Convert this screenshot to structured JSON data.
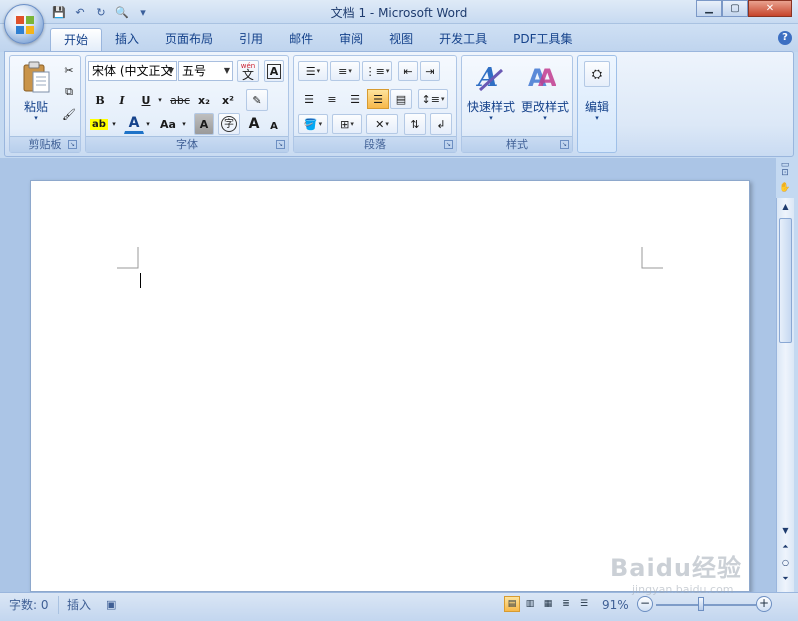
{
  "window": {
    "title": "文档 1 - Microsoft Word"
  },
  "tabs": [
    {
      "label": "开始",
      "active": true
    },
    {
      "label": "插入"
    },
    {
      "label": "页面布局"
    },
    {
      "label": "引用"
    },
    {
      "label": "邮件"
    },
    {
      "label": "审阅"
    },
    {
      "label": "视图"
    },
    {
      "label": "开发工具"
    },
    {
      "label": "PDF工具集"
    }
  ],
  "ribbon": {
    "clipboard": {
      "label": "剪贴板",
      "paste": "粘贴"
    },
    "font": {
      "label": "字体",
      "font_name": "宋体 (中文正文",
      "font_size": "五号",
      "bold": "B",
      "italic": "I",
      "underline": "U",
      "strike": "abc",
      "subscript": "x₂",
      "superscript": "x²",
      "grow": "A",
      "shrink": "A",
      "case": "Aa",
      "font_color": "A",
      "char_shade": "A",
      "enclose": "字",
      "phonetic": "wén",
      "phonetic_char": "文"
    },
    "paragraph": {
      "label": "段落"
    },
    "styles": {
      "label": "样式",
      "quick_styles": "快速样式",
      "change_styles": "更改样式"
    },
    "editing": {
      "label": "编辑"
    }
  },
  "status": {
    "word_count": "字数: 0",
    "mode": "插入",
    "zoom": "91%"
  },
  "watermark": {
    "brand": "Baidu经验",
    "url": "jingyan.baidu.com"
  },
  "colors": {
    "accent": "#15428b",
    "ribbon_bg": "#dce8f7",
    "highlight": "#f7b84a"
  }
}
